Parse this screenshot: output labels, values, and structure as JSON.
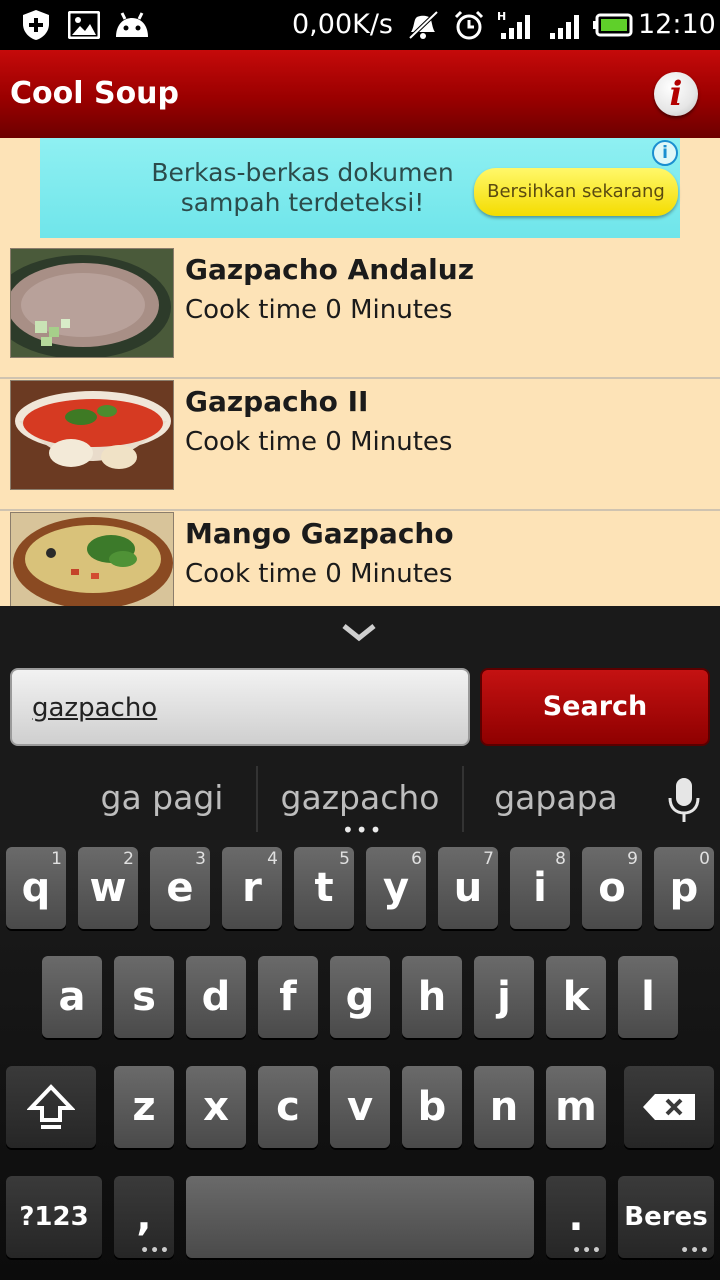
{
  "status_bar": {
    "speed": "0,00K/s",
    "time": "12:10",
    "icons": [
      "shield-plus-icon",
      "picture-icon",
      "android-icon",
      "mute-icon",
      "alarm-icon",
      "signal-h-icon",
      "signal-icon",
      "battery-icon"
    ]
  },
  "app_bar": {
    "title": "Cool Soup",
    "info_symbol": "i"
  },
  "ad": {
    "text": "Berkas-berkas dokumen sampah terdeteksi!",
    "button": "Bersihkan sekarang",
    "info_symbol": "i"
  },
  "recipes": [
    {
      "title": "Gazpacho Andaluz",
      "subtitle": "Cook time 0 Minutes"
    },
    {
      "title": "Gazpacho II",
      "subtitle": "Cook time 0 Minutes"
    },
    {
      "title": "Mango Gazpacho",
      "subtitle": "Cook time 0 Minutes"
    }
  ],
  "search": {
    "value": "gazpacho",
    "button": "Search"
  },
  "keyboard": {
    "suggestions": [
      "ga pagi",
      "gazpacho",
      "gapapa"
    ],
    "row1": [
      {
        "key": "q",
        "num": "1"
      },
      {
        "key": "w",
        "num": "2"
      },
      {
        "key": "e",
        "num": "3"
      },
      {
        "key": "r",
        "num": "4"
      },
      {
        "key": "t",
        "num": "5"
      },
      {
        "key": "y",
        "num": "6"
      },
      {
        "key": "u",
        "num": "7"
      },
      {
        "key": "i",
        "num": "8"
      },
      {
        "key": "o",
        "num": "9"
      },
      {
        "key": "p",
        "num": "0"
      }
    ],
    "row2": [
      "a",
      "s",
      "d",
      "f",
      "g",
      "h",
      "j",
      "k",
      "l"
    ],
    "row3": [
      "z",
      "x",
      "c",
      "v",
      "b",
      "n",
      "m"
    ],
    "symbols_key": "?123",
    "comma_key": ",",
    "period_key": ".",
    "done_key": "Beres"
  },
  "colors": {
    "app_bar": "#b00000",
    "list_background": "#fde3b7",
    "search_button": "#b30000",
    "ad_background": "#80ecef",
    "ad_button": "#f7e41a"
  }
}
